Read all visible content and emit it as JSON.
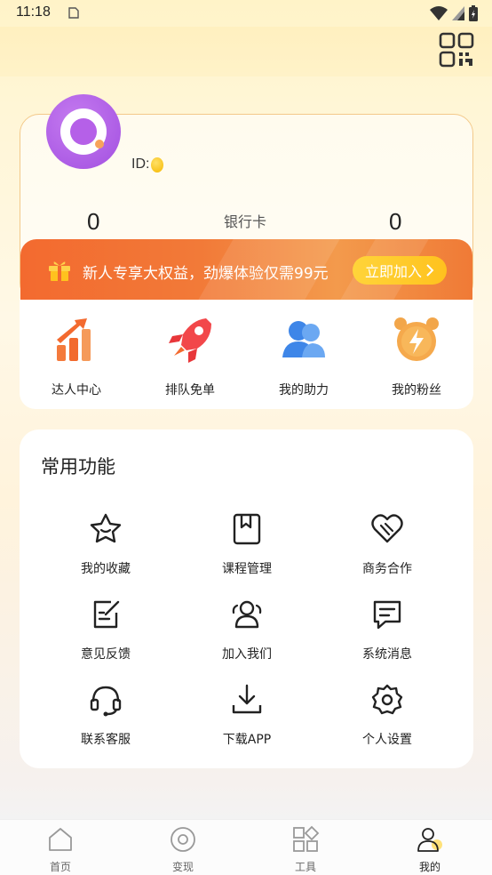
{
  "status_bar": {
    "time": "11:18"
  },
  "profile": {
    "id_label": "ID:",
    "stats": {
      "left_value": "0",
      "middle_label": "银行卡",
      "right_value": "0"
    }
  },
  "promo": {
    "text": "新人专享大权益，劲爆体验仅需99元",
    "button_label": "立即加入"
  },
  "quick_actions": [
    {
      "label": "达人中心",
      "icon": "growth-chart-icon"
    },
    {
      "label": "排队免单",
      "icon": "rocket-icon"
    },
    {
      "label": "我的助力",
      "icon": "users-icon"
    },
    {
      "label": "我的粉丝",
      "icon": "alarm-clock-icon"
    }
  ],
  "common": {
    "title": "常用功能",
    "items": [
      {
        "label": "我的收藏",
        "icon": "star-icon"
      },
      {
        "label": "课程管理",
        "icon": "bookmark-book-icon"
      },
      {
        "label": "商务合作",
        "icon": "heart-handshake-icon"
      },
      {
        "label": "意见反馈",
        "icon": "feedback-edit-icon"
      },
      {
        "label": "加入我们",
        "icon": "group-icon"
      },
      {
        "label": "系统消息",
        "icon": "message-icon"
      },
      {
        "label": "联系客服",
        "icon": "headset-icon"
      },
      {
        "label": "下载APP",
        "icon": "download-icon"
      },
      {
        "label": "个人设置",
        "icon": "gear-icon"
      }
    ]
  },
  "bottom_nav": [
    {
      "label": "首页",
      "icon": "home-icon"
    },
    {
      "label": "变现",
      "icon": "monetize-icon"
    },
    {
      "label": "工具",
      "icon": "tools-icon"
    },
    {
      "label": "我的",
      "icon": "profile-icon",
      "active": true
    }
  ],
  "colors": {
    "promo_orange": "#F36A2F",
    "promo_button": "#FFC21E",
    "avatar_purple": "#A24FE0",
    "accent_yellow": "#F6B800"
  }
}
